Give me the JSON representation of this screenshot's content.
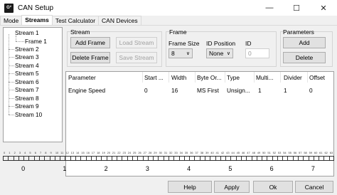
{
  "window": {
    "title": "CAN Setup",
    "icon_text": "G²"
  },
  "tabs": [
    "Mode",
    "Streams",
    "Test Calculator",
    "CAN Devices"
  ],
  "tree": [
    {
      "label": "Stream 1"
    },
    {
      "label": "Frame 1"
    },
    {
      "label": "Stream 2"
    },
    {
      "label": "Stream 3"
    },
    {
      "label": "Stream 4"
    },
    {
      "label": "Stream 5"
    },
    {
      "label": "Stream 6"
    },
    {
      "label": "Stream 7"
    },
    {
      "label": "Stream 8"
    },
    {
      "label": "Stream 9"
    },
    {
      "label": "Stream 10"
    }
  ],
  "stream_group": {
    "label": "Stream",
    "add_frame": "Add Frame",
    "load_stream": "Load Stream",
    "delete_frame": "Delete Frame",
    "save_stream": "Save Stream"
  },
  "frame_group": {
    "label": "Frame",
    "frame_size_label": "Frame Size",
    "frame_size_value": "8",
    "id_position_label": "ID Position",
    "id_position_value": "None",
    "id_label": "ID",
    "id_placeholder": "0"
  },
  "parameters_group": {
    "label": "Parameters",
    "add": "Add",
    "delete": "Delete"
  },
  "table": {
    "headers": [
      "Parameter",
      "Start ...",
      "Width",
      "Byte Or...",
      "Type",
      "Multi...",
      "Divider",
      "Offset"
    ],
    "rows": [
      [
        "Engine Speed",
        "0",
        "16",
        "MS First",
        "Unsign...",
        "1",
        "1",
        "0"
      ]
    ]
  },
  "bit_numbers": [
    "0",
    "1",
    "2",
    "3",
    "4",
    "5",
    "6",
    "7",
    "8",
    "9",
    "10",
    "11",
    "12",
    "13",
    "14",
    "15",
    "16",
    "17",
    "18",
    "19",
    "20",
    "21",
    "22",
    "23",
    "24",
    "25",
    "26",
    "27",
    "28",
    "29",
    "30",
    "31",
    "32",
    "33",
    "34",
    "35",
    "36",
    "37",
    "38",
    "39",
    "40",
    "41",
    "42",
    "43",
    "44",
    "45",
    "46",
    "47",
    "48",
    "49",
    "50",
    "51",
    "52",
    "53",
    "54",
    "55",
    "56",
    "57",
    "58",
    "59",
    "60",
    "61",
    "62",
    "63"
  ],
  "byte_labels": [
    "0",
    "1",
    "2",
    "3",
    "4",
    "5",
    "6",
    "7"
  ],
  "footer": {
    "help": "Help",
    "apply": "Apply",
    "ok": "Ok",
    "cancel": "Cancel"
  }
}
